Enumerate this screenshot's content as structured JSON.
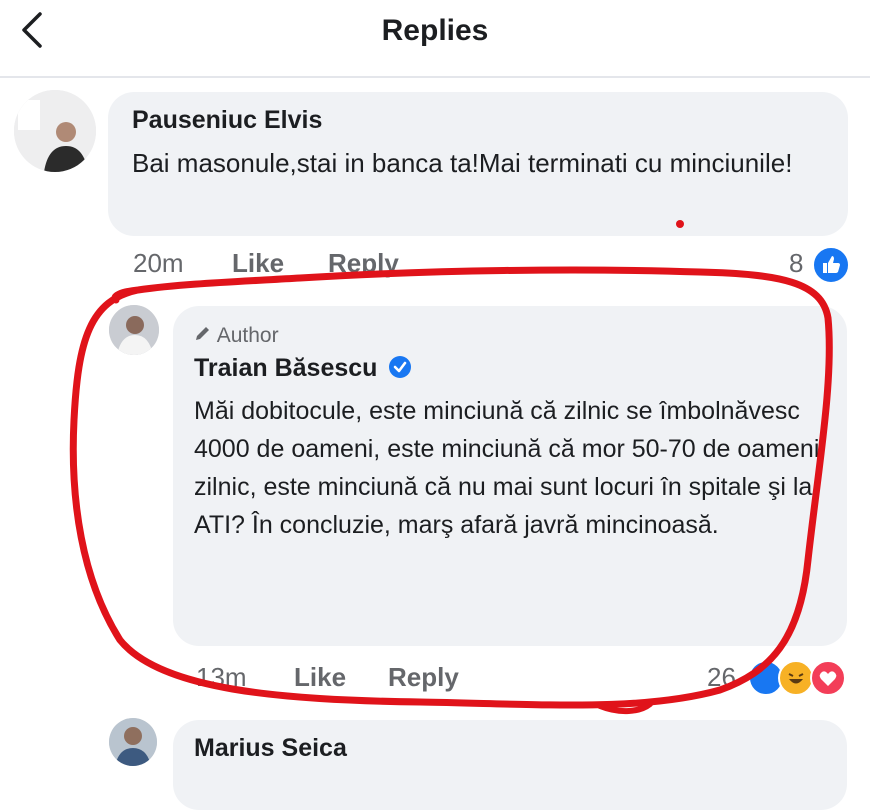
{
  "header": {
    "title": "Replies"
  },
  "comments": [
    {
      "name": "Pauseniuc Elvis",
      "text": "Bai masonule,stai in banca ta!Mai terminati cu minciunile!",
      "time": "20m",
      "like": "Like",
      "reply": "Reply",
      "reactions": "8"
    },
    {
      "badge": "Author",
      "name": "Traian Băsescu",
      "text": "Măi dobitocule, este minciună că zilnic se îmbolnăvesc 4000 de oameni, este minciună că mor 50-70 de oameni zilnic, este minciună că nu mai sunt locuri în spitale şi la ATI? În concluzie, marş afară javră mincinoasă.",
      "time": "13m",
      "like": "Like",
      "reply": "Reply",
      "reactions": "26"
    },
    {
      "name": "Marius Seica"
    }
  ],
  "colors": {
    "accent": "#1877f2",
    "annotation": "#e0131a",
    "bubble": "#f0f2f5"
  }
}
